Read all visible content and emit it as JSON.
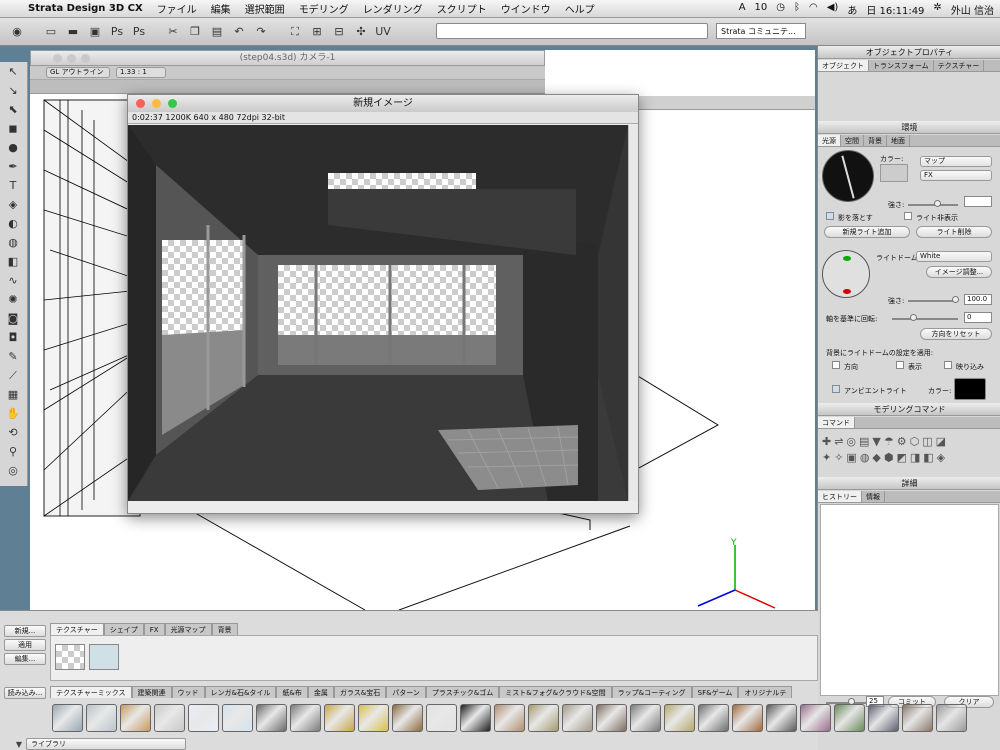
{
  "menubar": {
    "app_name": "Strata Design 3D CX",
    "items": [
      "ファイル",
      "編集",
      "選択範囲",
      "モデリング",
      "レンダリング",
      "スクリプト",
      "ウインドウ",
      "ヘルプ"
    ],
    "adobe_badge": "10",
    "clock": "日 16:11:49",
    "user": "外山 信治"
  },
  "toolbar": {
    "community_label": "Strata コミュニテ..."
  },
  "camera_window": {
    "title": "(step04.s3d) カメラ-1",
    "view_mode": "GL アウトライン",
    "zoom": "1.33 : 1"
  },
  "render_window": {
    "title": "新規イメージ",
    "info": "0:02:37   1200K   640 x 480   72dpi   32-bit"
  },
  "object_properties": {
    "title": "オブジェクトプロパティ",
    "tabs": [
      "オブジェクト",
      "トランスフォーム",
      "テクスチャー"
    ]
  },
  "environment": {
    "title": "環境",
    "tabs": [
      "光源",
      "空間",
      "背景",
      "地面"
    ],
    "color_label": "カラー:",
    "light_type": "マップ",
    "fx": "FX",
    "strength_label": "強さ:",
    "cast_shadow_label": "影を落とす",
    "hide_light_label": "ライト非表示",
    "add_light_button": "新規ライト追加",
    "delete_light_button": "ライト削除",
    "light_dome_label": "ライトドーム:",
    "light_dome_value": "White",
    "image_adjust_button": "イメージ調整...",
    "strength2_label": "強さ:",
    "strength2_value": "100.0",
    "rotate_label": "軸を基準に回転:",
    "rotate_value": "0",
    "reset_direction_button": "方向をリセット",
    "apply_dome_label": "背景にライトドームの設定を適用:",
    "direction_label": "方向",
    "display_label": "表示",
    "reflect_label": "映り込み",
    "ambient_label": "アンビエントライト",
    "ambient_color_label": "カラー:"
  },
  "modeling_commands": {
    "title": "モデリングコマンド",
    "tab": "コマンド"
  },
  "details": {
    "title": "詳細",
    "tabs": [
      "ヒストリー",
      "情報"
    ],
    "history_value": "25",
    "commit_button": "コミット",
    "clear_button": "クリア"
  },
  "resource_palette": {
    "side_buttons": [
      "新規...",
      "適用",
      "編集...",
      "読み込み..."
    ],
    "tabs": [
      "テクスチャー",
      "シェイプ",
      "FX",
      "光源マップ",
      "背景"
    ],
    "library_tabs": [
      "テクスチャーミックス",
      "建築関連",
      "ウッド",
      "レンガ&石&タイル",
      "紙&布",
      "金属",
      "ガラス&宝石",
      "パターン",
      "プラスチック&ゴム",
      "ミスト&フォグ&クラウド&空間",
      "ラップ&コーティング",
      "SF&ゲーム",
      "オリジナルテ"
    ],
    "library_button": "ライブラリ",
    "swatch_colors": [
      "#9aa7b2",
      "#b9c3cc",
      "#c89a5e",
      "#c9c9c9",
      "#e8eef7",
      "#d4e3ee",
      "#6b6b6b",
      "#7a7a7a",
      "#c8a646",
      "#d8c04a",
      "#8c6a3f",
      "#e2e2e2",
      "#202020",
      "#b08d6d",
      "#a39a6e",
      "#a29988",
      "#7d6d62",
      "#7a7a7a",
      "#b5a86d",
      "#6e6e6e",
      "#a36a3c",
      "#5a5a5a",
      "#9c6d8c",
      "#6a8a5a",
      "#5d6070",
      "#8a7a6a",
      "#9a9a9a",
      "#6a5adc"
    ]
  }
}
